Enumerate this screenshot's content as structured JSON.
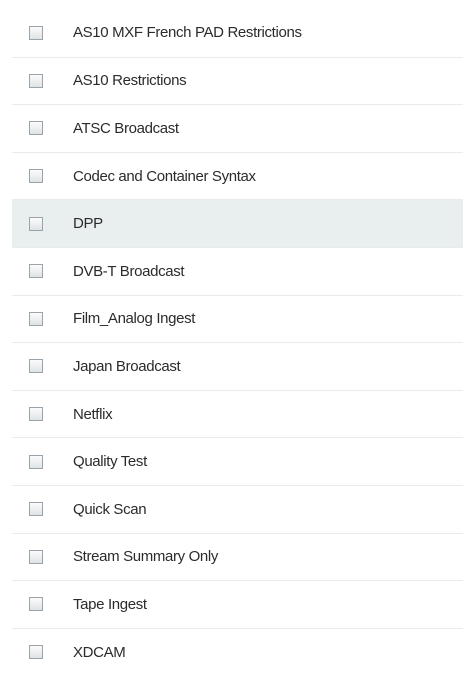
{
  "profiles": {
    "items": [
      {
        "label": "AS10 MXF French PAD Restrictions",
        "checked": false,
        "highlighted": false
      },
      {
        "label": "AS10 Restrictions",
        "checked": false,
        "highlighted": false
      },
      {
        "label": "ATSC Broadcast",
        "checked": false,
        "highlighted": false
      },
      {
        "label": "Codec and Container Syntax",
        "checked": false,
        "highlighted": false
      },
      {
        "label": "DPP",
        "checked": false,
        "highlighted": true
      },
      {
        "label": "DVB-T Broadcast",
        "checked": false,
        "highlighted": false
      },
      {
        "label": "Film_Analog Ingest",
        "checked": false,
        "highlighted": false
      },
      {
        "label": "Japan Broadcast",
        "checked": false,
        "highlighted": false
      },
      {
        "label": "Netflix",
        "checked": false,
        "highlighted": false
      },
      {
        "label": "Quality Test",
        "checked": false,
        "highlighted": false
      },
      {
        "label": "Quick Scan",
        "checked": false,
        "highlighted": false
      },
      {
        "label": "Stream Summary Only",
        "checked": false,
        "highlighted": false
      },
      {
        "label": "Tape Ingest",
        "checked": false,
        "highlighted": false
      },
      {
        "label": "XDCAM",
        "checked": false,
        "highlighted": false
      }
    ]
  },
  "colors": {
    "highlight_row": "#e9eeef",
    "divider": "#e7ebee",
    "text": "#2b2b2b",
    "checkbox_border": "#9aa3a9"
  }
}
